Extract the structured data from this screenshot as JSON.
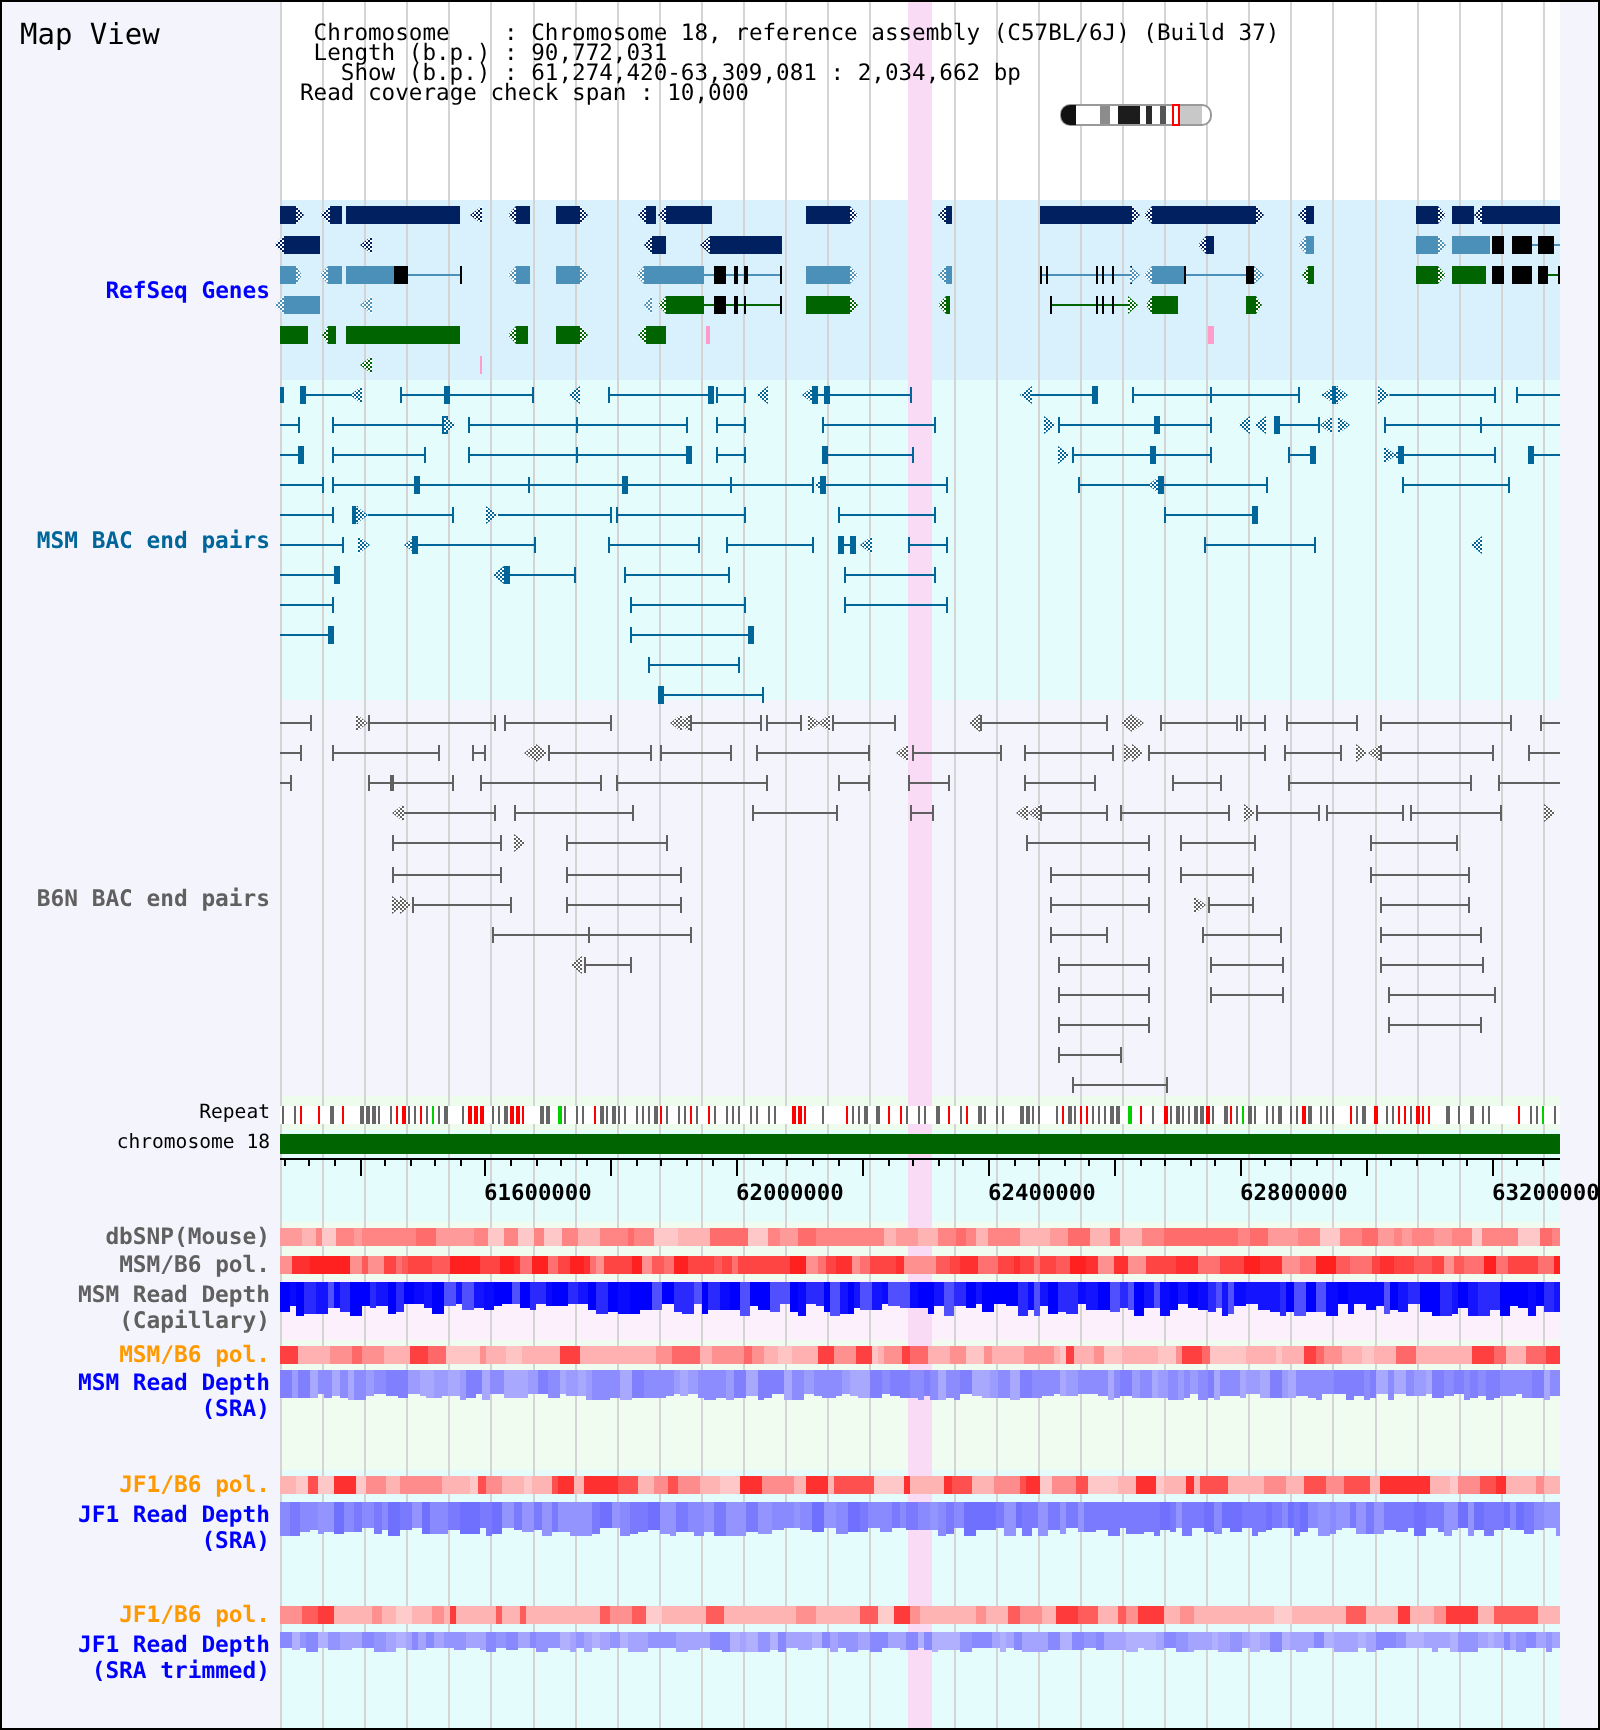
{
  "title": "Map View",
  "info_lines": [
    "Chromosome    : Chromosome 18, reference assembly (C57BL/6J) (Build 37)",
    "Length (b.p.) : 90,772,031",
    "Show (b.p.) : 61,274,420-63,309,081 : 2,034,662 bp",
    "Read coverage check span : 10,000"
  ],
  "tracks": [
    {
      "kind": "genes",
      "label": "RefSeq Genes",
      "color": "#0000ff"
    },
    {
      "kind": "pairs",
      "label": "MSM BAC end pairs",
      "color": "#006699"
    },
    {
      "kind": "pairs",
      "label": "B6N BAC end pairs",
      "color": "#606060"
    },
    {
      "kind": "repeat",
      "label": "Repeat",
      "color": "#000000"
    },
    {
      "kind": "chromosome",
      "label": "chromosome 18",
      "color": "#000000"
    },
    {
      "kind": "ruler",
      "ticks": [
        "61600000",
        "62000000",
        "62400000",
        "62800000",
        "63200000"
      ]
    },
    {
      "kind": "heat",
      "label": "dbSNP(Mouse)",
      "color": "#606060"
    },
    {
      "kind": "heat",
      "label": "MSM/B6 pol.",
      "color": "#606060"
    },
    {
      "kind": "depth",
      "label": "MSM Read Depth",
      "sublabel": "(Capillary)",
      "color": "#606060"
    },
    {
      "kind": "heat",
      "label": "MSM/B6 pol.",
      "color": "#ff9900"
    },
    {
      "kind": "depth",
      "label": "MSM Read Depth",
      "sublabel": "(SRA)",
      "color": "#0000ff"
    },
    {
      "kind": "heat",
      "label": "JF1/B6 pol.",
      "color": "#ff9900"
    },
    {
      "kind": "depth",
      "label": "JF1 Read Depth",
      "sublabel": "(SRA)",
      "color": "#0000ff"
    },
    {
      "kind": "heat",
      "label": "JF1/B6 pol.",
      "color": "#ff9900"
    },
    {
      "kind": "depth",
      "label": "JF1 Read Depth",
      "sublabel": "(SRA trimmed)",
      "color": "#0000ff"
    }
  ]
}
